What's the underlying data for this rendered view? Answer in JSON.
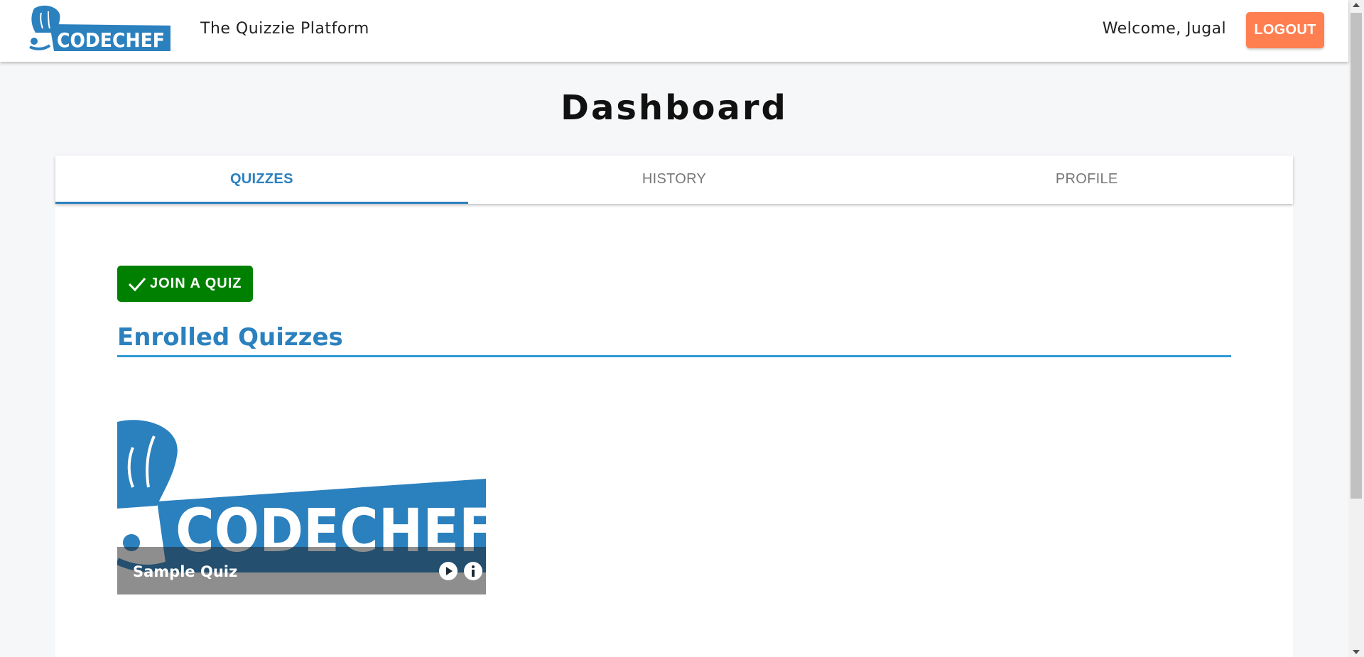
{
  "header": {
    "logo_text": "CODECHEF",
    "app_title": "The Quizzie Platform",
    "welcome": "Welcome, Jugal",
    "logout_label": "LOGOUT"
  },
  "page": {
    "title": "Dashboard"
  },
  "tabs": [
    {
      "label": "QUIZZES",
      "active": true
    },
    {
      "label": "HISTORY",
      "active": false
    },
    {
      "label": "PROFILE",
      "active": false
    }
  ],
  "main": {
    "join_label": "JOIN A QUIZ",
    "enrolled_title": "Enrolled Quizzes",
    "quizzes": [
      {
        "name": "Sample Quiz",
        "image_text": "CODECHEF"
      }
    ]
  },
  "colors": {
    "accent": "#2b80be",
    "logout": "#ff7f50",
    "join": "#008000"
  },
  "icons": [
    "codechef-logo",
    "check-icon",
    "play-icon",
    "info-icon"
  ]
}
